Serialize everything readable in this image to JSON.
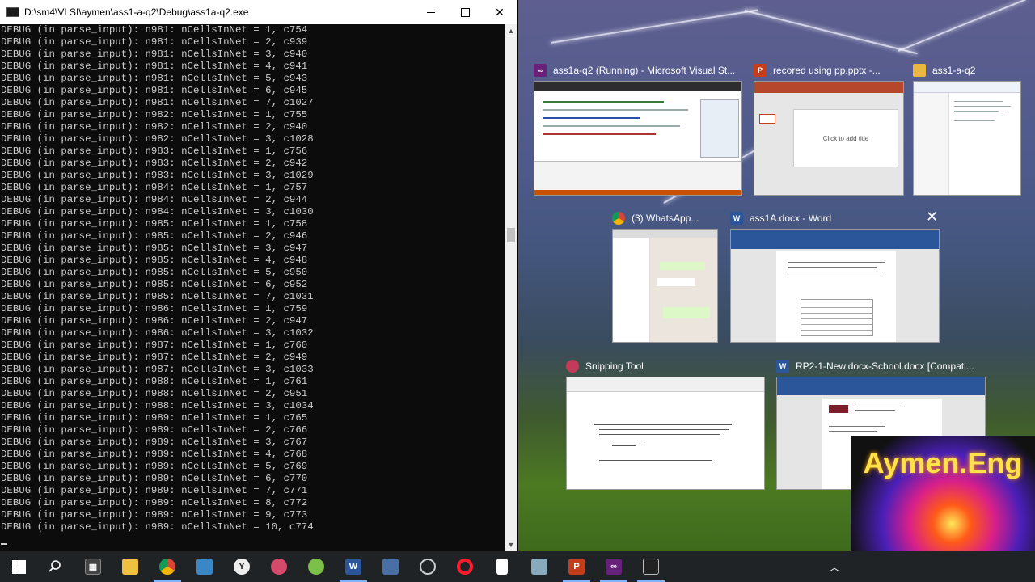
{
  "console": {
    "title": "D:\\sm4\\VLSI\\aymen\\ass1-a-q2\\Debug\\ass1a-q2.exe",
    "lines": [
      "DEBUG (in parse_input): n981: nCellsInNet = 1, c754",
      "DEBUG (in parse_input): n981: nCellsInNet = 2, c939",
      "DEBUG (in parse_input): n981: nCellsInNet = 3, c940",
      "DEBUG (in parse_input): n981: nCellsInNet = 4, c941",
      "DEBUG (in parse_input): n981: nCellsInNet = 5, c943",
      "DEBUG (in parse_input): n981: nCellsInNet = 6, c945",
      "DEBUG (in parse_input): n981: nCellsInNet = 7, c1027",
      "DEBUG (in parse_input): n982: nCellsInNet = 1, c755",
      "DEBUG (in parse_input): n982: nCellsInNet = 2, c940",
      "DEBUG (in parse_input): n982: nCellsInNet = 3, c1028",
      "DEBUG (in parse_input): n983: nCellsInNet = 1, c756",
      "DEBUG (in parse_input): n983: nCellsInNet = 2, c942",
      "DEBUG (in parse_input): n983: nCellsInNet = 3, c1029",
      "DEBUG (in parse_input): n984: nCellsInNet = 1, c757",
      "DEBUG (in parse_input): n984: nCellsInNet = 2, c944",
      "DEBUG (in parse_input): n984: nCellsInNet = 3, c1030",
      "DEBUG (in parse_input): n985: nCellsInNet = 1, c758",
      "DEBUG (in parse_input): n985: nCellsInNet = 2, c946",
      "DEBUG (in parse_input): n985: nCellsInNet = 3, c947",
      "DEBUG (in parse_input): n985: nCellsInNet = 4, c948",
      "DEBUG (in parse_input): n985: nCellsInNet = 5, c950",
      "DEBUG (in parse_input): n985: nCellsInNet = 6, c952",
      "DEBUG (in parse_input): n985: nCellsInNet = 7, c1031",
      "DEBUG (in parse_input): n986: nCellsInNet = 1, c759",
      "DEBUG (in parse_input): n986: nCellsInNet = 2, c947",
      "DEBUG (in parse_input): n986: nCellsInNet = 3, c1032",
      "DEBUG (in parse_input): n987: nCellsInNet = 1, c760",
      "DEBUG (in parse_input): n987: nCellsInNet = 2, c949",
      "DEBUG (in parse_input): n987: nCellsInNet = 3, c1033",
      "DEBUG (in parse_input): n988: nCellsInNet = 1, c761",
      "DEBUG (in parse_input): n988: nCellsInNet = 2, c951",
      "DEBUG (in parse_input): n988: nCellsInNet = 3, c1034",
      "DEBUG (in parse_input): n989: nCellsInNet = 1, c765",
      "DEBUG (in parse_input): n989: nCellsInNet = 2, c766",
      "DEBUG (in parse_input): n989: nCellsInNet = 3, c767",
      "DEBUG (in parse_input): n989: nCellsInNet = 4, c768",
      "DEBUG (in parse_input): n989: nCellsInNet = 5, c769",
      "DEBUG (in parse_input): n989: nCellsInNet = 6, c770",
      "DEBUG (in parse_input): n989: nCellsInNet = 7, c771",
      "DEBUG (in parse_input): n989: nCellsInNet = 8, c772",
      "DEBUG (in parse_input): n989: nCellsInNet = 9, c773",
      "DEBUG (in parse_input): n989: nCellsInNet = 10, c774"
    ]
  },
  "task_view": {
    "windows": [
      {
        "title": "ass1a-q2 (Running) - Microsoft Visual St...",
        "icon": "visual-studio-icon"
      },
      {
        "title": "recored using pp.pptx -...",
        "icon": "powerpoint-icon",
        "slide_placeholder": "Click to add title"
      },
      {
        "title": "ass1-a-q2",
        "icon": "folder-icon"
      },
      {
        "title": "(3) WhatsApp...",
        "icon": "chrome-icon"
      },
      {
        "title": "ass1A.docx - Word",
        "icon": "word-icon"
      },
      {
        "title": "Snipping Tool",
        "icon": "snipping-tool-icon"
      },
      {
        "title": "RP2-1-New.docx-School.docx [Compati...",
        "icon": "word-icon"
      }
    ]
  },
  "watermark": {
    "text": "Aymen.Eng"
  },
  "taskbar": {
    "items": [
      "start-icon",
      "search-icon",
      "calculator-icon",
      "file-explorer-icon",
      "chrome-icon",
      "app-icon",
      "app-icon",
      "app-icon",
      "app-icon",
      "word-icon",
      "app-icon",
      "app-icon",
      "opera-icon",
      "file-icon",
      "app-icon",
      "powerpoint-icon",
      "visual-studio-icon",
      "console-icon"
    ]
  },
  "colors": {
    "console_bg": "#0c0c0c",
    "console_text": "#cccccc",
    "taskbar": "#1f2326",
    "accent": "#7fb2ff"
  }
}
